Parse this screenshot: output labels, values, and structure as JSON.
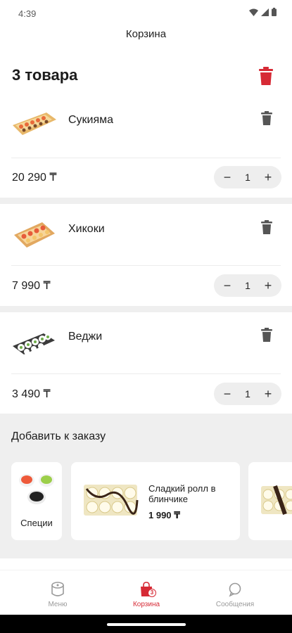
{
  "status_bar": {
    "time": "4:39"
  },
  "header": {
    "title": "Корзина"
  },
  "cart": {
    "count_label": "3 товара",
    "items": [
      {
        "name": "Сукияма",
        "price": "20 290 ₸",
        "quantity": "1"
      },
      {
        "name": "Хикоки",
        "price": "7 990 ₸",
        "quantity": "1"
      },
      {
        "name": "Веджи",
        "price": "3 490 ₸",
        "quantity": "1"
      }
    ],
    "minus": "−",
    "plus": "+"
  },
  "addons": {
    "title": "Добавить к заказу",
    "items": [
      {
        "name": "Специи"
      },
      {
        "name": "Сладкий ролл в блинчике",
        "price": "1 990 ₸"
      }
    ]
  },
  "nav": {
    "items": [
      {
        "label": "Меню"
      },
      {
        "label": "Корзина",
        "badge": "3"
      },
      {
        "label": "Сообщения"
      }
    ]
  },
  "colors": {
    "accent": "#d62a35",
    "surface": "#efefef"
  }
}
